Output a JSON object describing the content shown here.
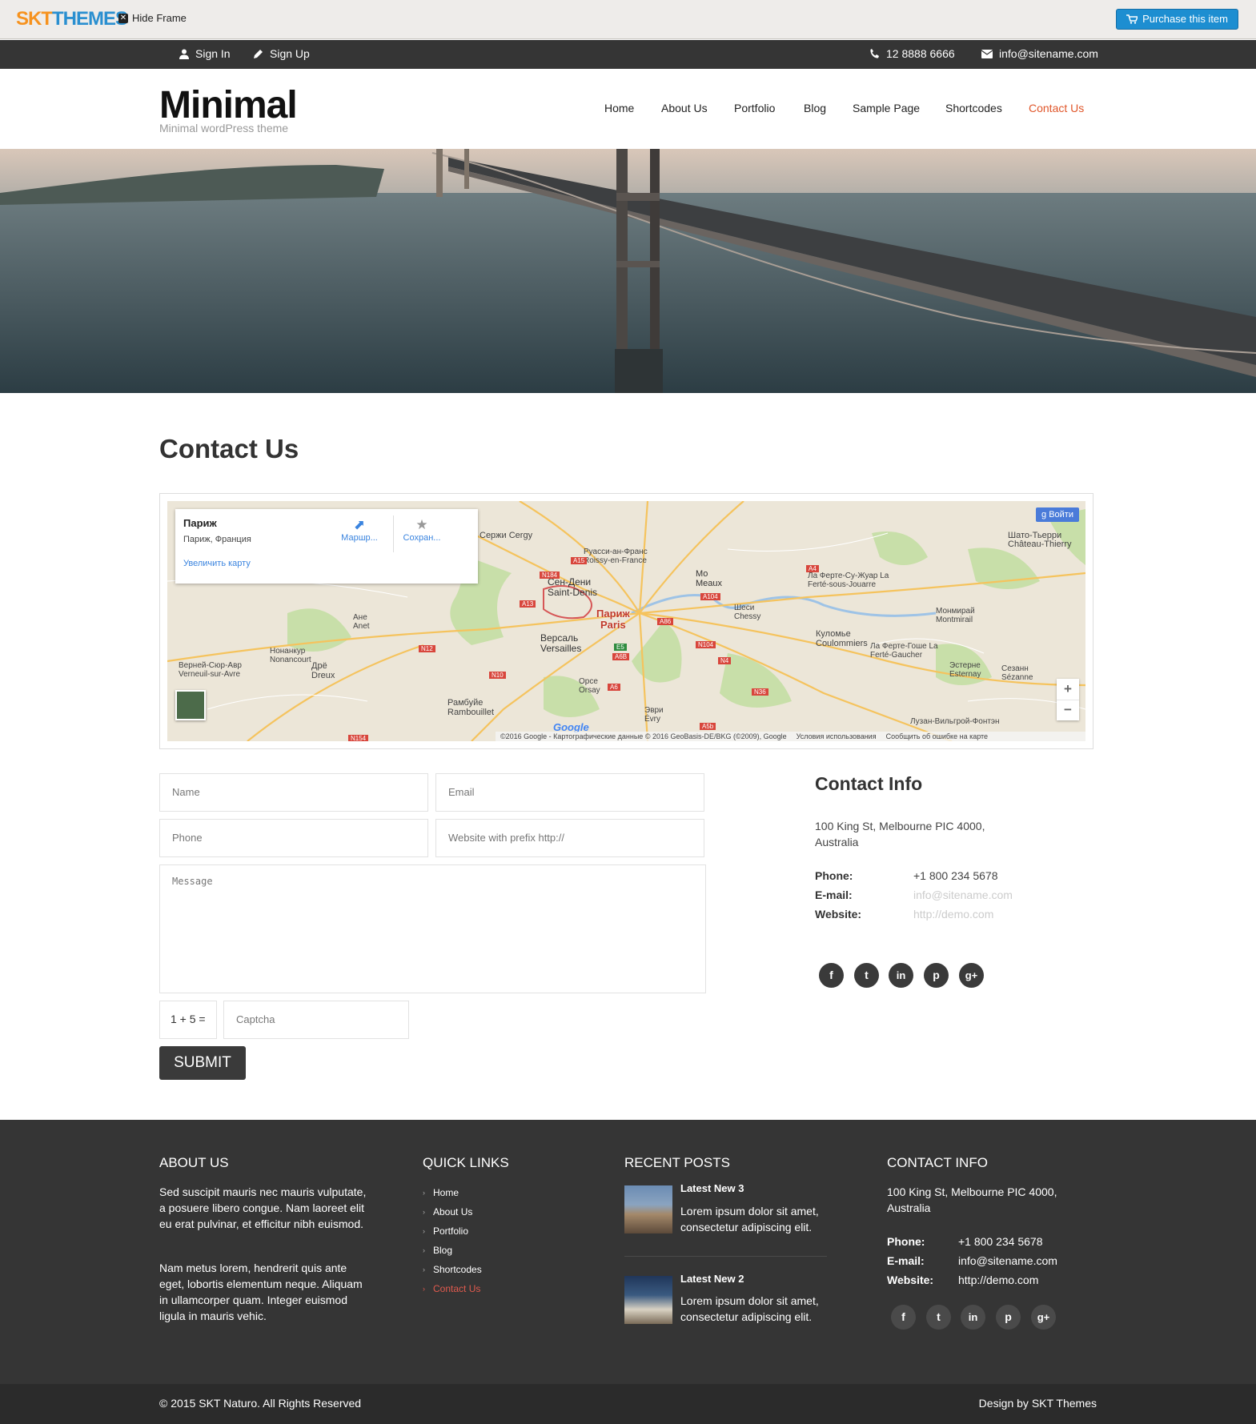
{
  "frame": {
    "logo_s": "SKT",
    "logo_t": "THEMES",
    "hide_frame": "Hide Frame",
    "purchase": "Purchase this item"
  },
  "topbar": {
    "sign_in": "Sign In",
    "sign_up": "Sign Up",
    "phone": "12 8888 6666",
    "email": "info@sitename.com"
  },
  "header": {
    "brand": "Minimal",
    "tagline": "Minimal wordPress theme",
    "nav": [
      "Home",
      "About Us",
      "Portfolio",
      "Blog",
      "Sample Page",
      "Shortcodes",
      "Contact Us"
    ],
    "active_color": "#e0562a"
  },
  "page": {
    "title": "Contact Us"
  },
  "map": {
    "place_title": "Париж",
    "place_sub": "Париж, Франция",
    "route": "Маршр...",
    "save": "Сохран...",
    "enlarge": "Увеличить карту",
    "signin": "Войти",
    "center_label": "Париж",
    "center_label_latin": "Paris",
    "attribution": "©2016 Google - Картографические данные © 2016 GeoBasis-DE/BKG (©2009), Google",
    "terms": "Условия использования",
    "report": "Сообщить об ошибке на карте",
    "google": "Google",
    "zoom_in": "+",
    "zoom_out": "−",
    "labels": [
      "Сержи Cergy",
      "Руасси-ан-Франс Roissy-en-France",
      "Сен-Дени Saint-Denis",
      "Мо Meaux",
      "Шато-Тьерри Château-Thierry",
      "Ла Ферте-Су-Жуар La Ferté-sous-Jouarre",
      "Ане Anet",
      "Шеси Chessy",
      "Монмирай Montmirail",
      "Нонанкур Nonancourt",
      "Версаль Versailles",
      "Куломье Coulommiers",
      "Ла Ферте-Гоше La Ferté-Gaucher",
      "Верней-Сюр-Авр Verneuil-sur-Avre",
      "Дрё Dreux",
      "Орсе Orsay",
      "Эстерне Esternay",
      "Сезанн Sézanne",
      "Рамбуйе Rambouillet",
      "Эври Évry",
      "Лузан-Вильгрой-Фонтэн"
    ],
    "roads": [
      "A15",
      "N184",
      "A13",
      "N12",
      "A104",
      "A86",
      "N104",
      "N4",
      "E5",
      "A6B",
      "N10",
      "A6",
      "N36",
      "A5b",
      "N154",
      "A4"
    ]
  },
  "form": {
    "name_ph": "Name",
    "email_ph": "Email",
    "phone_ph": "Phone",
    "website_ph": "Website with prefix http://",
    "message_ph": "Message",
    "captcha_q": "1 + 5 =",
    "captcha_ph": "Captcha",
    "submit": "SUBMIT"
  },
  "contact_info": {
    "title": "Contact Info",
    "address1": "100 King St, Melbourne PIC 4000,",
    "address2": "Australia",
    "phone_label": "Phone:",
    "phone": "+1 800 234 5678",
    "email_label": "E-mail:",
    "email": "info@sitename.com",
    "website_label": "Website:",
    "website": "http://demo.com",
    "social_icons": [
      "facebook-icon",
      "twitter-icon",
      "linkedin-icon",
      "pinterest-icon",
      "google-plus-icon"
    ]
  },
  "footer": {
    "about_title": "ABOUT US",
    "about_p1": "Sed suscipit mauris nec mauris vulputate, a posuere libero congue. Nam laoreet elit eu erat pulvinar, et efficitur nibh euismod.",
    "about_p2": "Nam metus lorem, hendrerit quis ante eget, lobortis elementum neque. Aliquam in ullamcorper quam. Integer euismod ligula in mauris vehic.",
    "links_title": "QUICK LINKS",
    "links": [
      "Home",
      "About Us",
      "Portfolio",
      "Blog",
      "Shortcodes",
      "Contact Us"
    ],
    "posts_title": "RECENT POSTS",
    "posts": [
      {
        "title": "Latest New 3",
        "text": "Lorem ipsum dolor sit amet, consectetur adipiscing elit."
      },
      {
        "title": "Latest New 2",
        "text": "Lorem ipsum dolor sit amet, consectetur adipiscing elit."
      }
    ],
    "contact_title": "CONTACT INFO",
    "address1": "100 King St, Melbourne PIC 4000,",
    "address2": "Australia",
    "phone_label": "Phone:",
    "phone": "+1 800 234 5678",
    "email_label": "E-mail:",
    "email": "info@sitename.com",
    "website_label": "Website:",
    "website": "http://demo.com"
  },
  "copyright": {
    "left": "© 2015 SKT Naturo. All Rights Reserved",
    "right": "Design by SKT Themes"
  }
}
